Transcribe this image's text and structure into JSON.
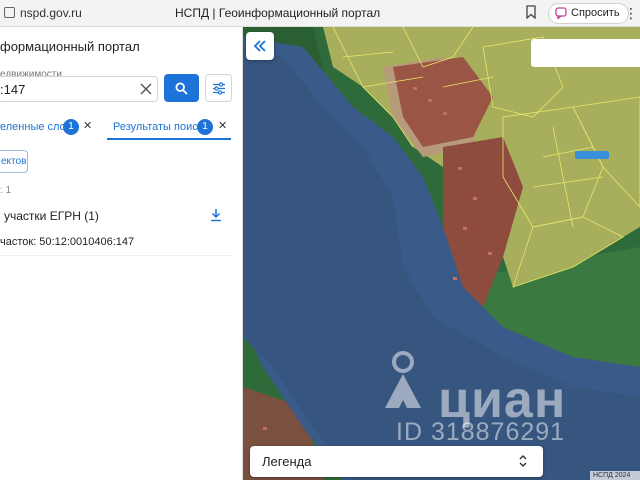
{
  "browser": {
    "url": "nspd.gov.ru",
    "tab_title": "НСПД | Геоинформационный портал",
    "ask_label": "Спросить"
  },
  "panel": {
    "portal_title": "формационный портал",
    "search_label": "едвижимости",
    "search_value": ":147",
    "tabs": [
      {
        "label": "еленные слои",
        "count": "1"
      },
      {
        "label": "Результаты поиска",
        "count": "1",
        "active": true
      }
    ],
    "objects_button": "ектов",
    "found_count": ": 1",
    "group_title": "участки ЕГРН (1)",
    "result_item": "часток: 50:12:0010406:147"
  },
  "map": {
    "legend_label": "Легенда",
    "attribution": "НСПД 2024",
    "watermark_name": "циан",
    "watermark_id": "ID 318876291"
  },
  "colors": {
    "accent": "#1e73d8",
    "parcel_outline": "#e8e86a",
    "water": "#3a5a8a",
    "forest": "#2f6b3a"
  },
  "icons": [
    "site-icon",
    "bookmark-icon",
    "ask-icon",
    "clear-icon",
    "search-icon",
    "filter-icon",
    "close-icon",
    "download-icon",
    "collapse-left-icon",
    "chevron-updown-icon"
  ]
}
